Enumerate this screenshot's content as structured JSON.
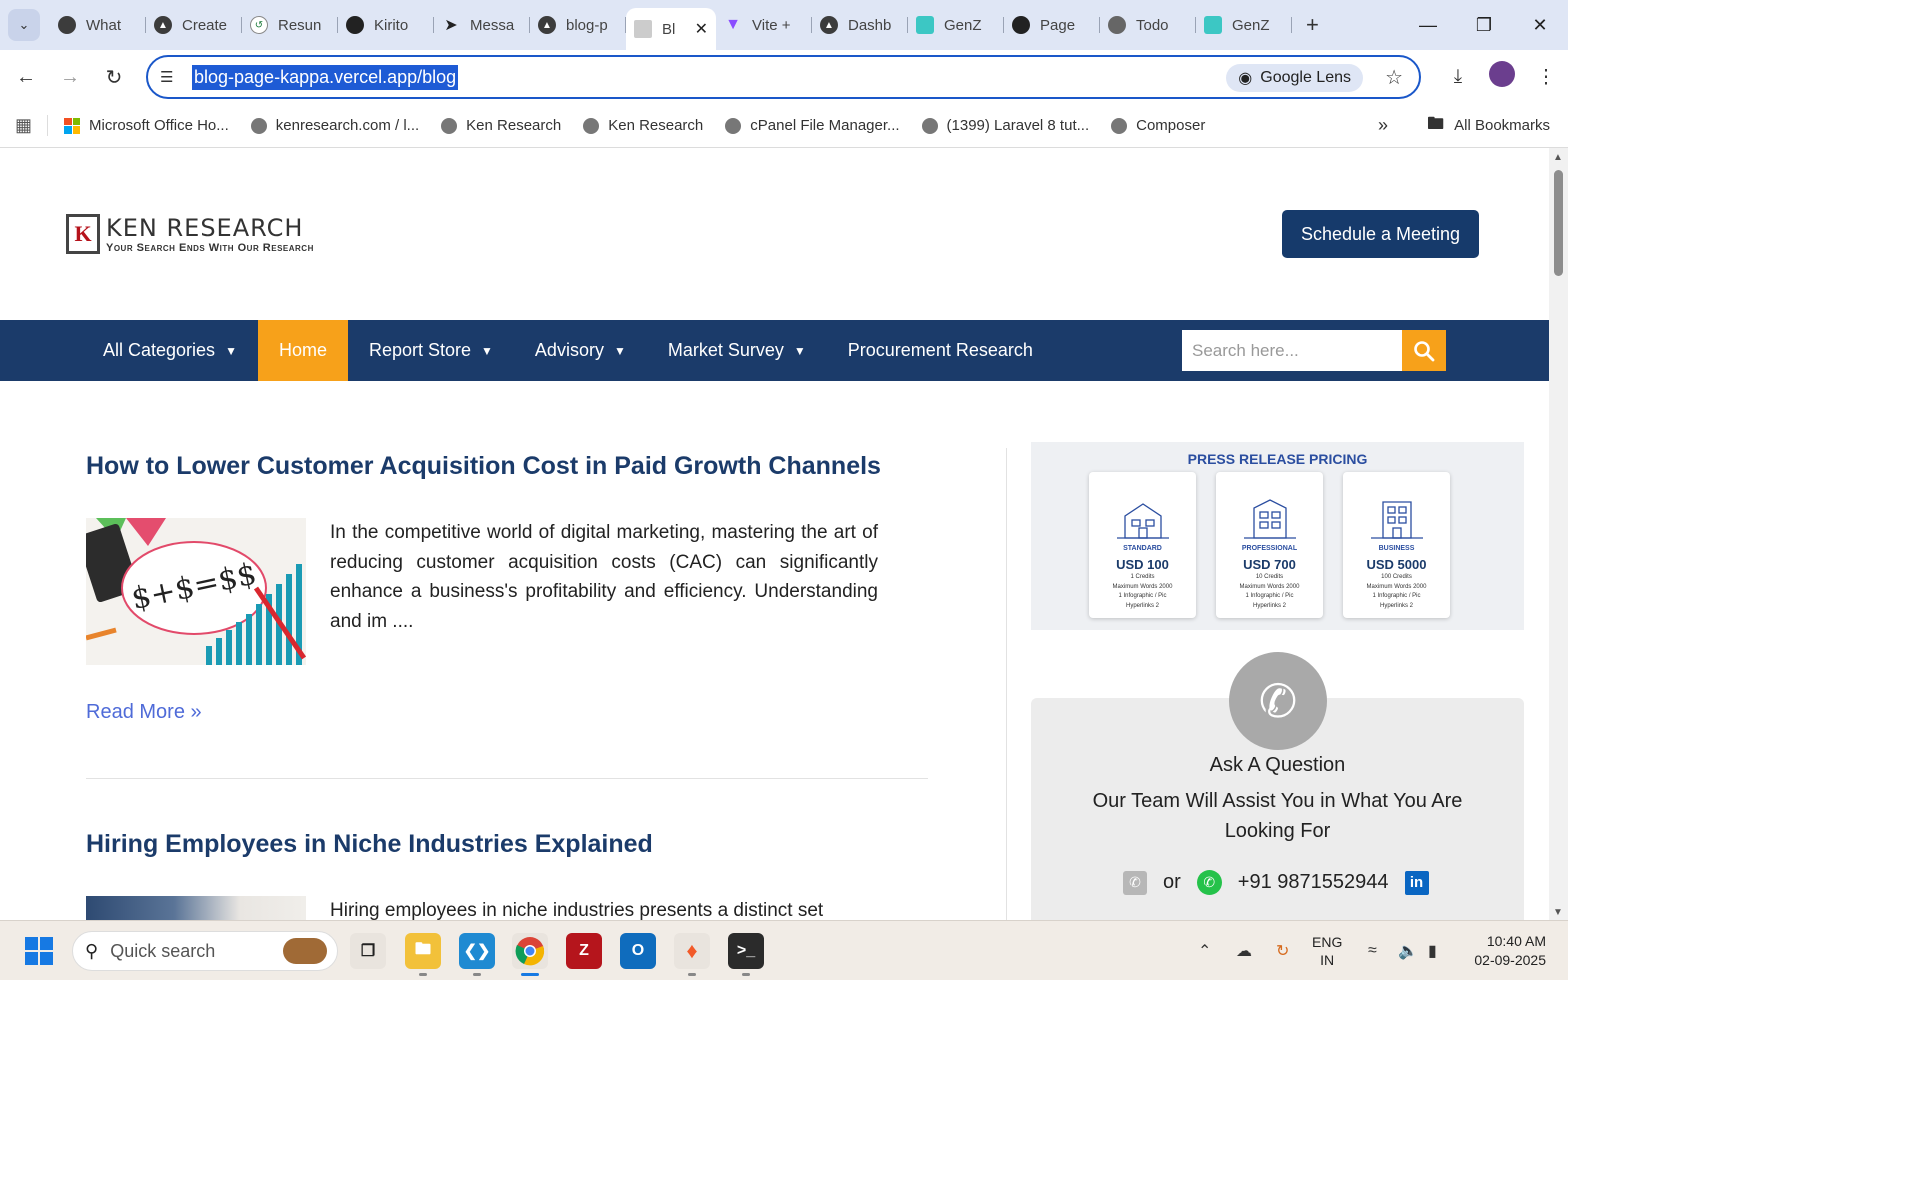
{
  "browser": {
    "tabs": [
      {
        "label": "What"
      },
      {
        "label": "Create"
      },
      {
        "label": "Resun"
      },
      {
        "label": "Kirito"
      },
      {
        "label": "Messa"
      },
      {
        "label": "blog-p"
      },
      {
        "label": "Bl",
        "active": true
      },
      {
        "label": "Vite +"
      },
      {
        "label": "Dashb"
      },
      {
        "label": "GenZ"
      },
      {
        "label": "Page"
      },
      {
        "label": "Todo"
      },
      {
        "label": "GenZ"
      }
    ],
    "url": "blog-page-kappa.vercel.app/blog",
    "lens_label": "Google Lens",
    "bookmarks": [
      "Microsoft Office Ho...",
      "kenresearch.com / l...",
      "Ken Research",
      "Ken Research",
      "cPanel File Manager...",
      "(1399) Laravel 8 tut...",
      "Composer"
    ],
    "all_bookmarks": "All Bookmarks"
  },
  "site": {
    "logo_name": "KEN RESEARCH",
    "logo_tagline": "Your Search Ends With Our Research",
    "schedule_button": "Schedule a Meeting",
    "nav": {
      "all_categories": "All Categories",
      "home": "Home",
      "report_store": "Report Store",
      "advisory": "Advisory",
      "market_survey": "Market Survey",
      "procurement": "Procurement Research"
    },
    "search_placeholder": "Search here...",
    "posts": [
      {
        "title": "How to Lower Customer Acquisition Cost in Paid Growth Channels",
        "excerpt": "In the competitive world of digital marketing, mastering the art of reducing customer acquisition costs (CAC) can significantly enhance a business's profitability and efficiency. Understanding and im ....",
        "read_more": "Read More »",
        "image_text": "$+$=$$"
      },
      {
        "title": "Hiring Employees in Niche Industries Explained",
        "excerpt": "Hiring employees in niche industries presents a distinct set"
      }
    ],
    "pricing": {
      "title": "PRESS RELEASE PRICING",
      "plans": [
        {
          "name": "STANDARD",
          "price": "USD 100",
          "credits": "1 Credits",
          "words": "Maximum Words 2000",
          "infographic": "1 Infographic / Pic",
          "links": "Hyperlinks 2"
        },
        {
          "name": "PROFESSIONAL",
          "price": "USD 700",
          "credits": "10 Credits",
          "words": "Maximum Words 2000",
          "infographic": "1 Infographic / Pic",
          "links": "Hyperlinks 2"
        },
        {
          "name": "BUSINESS",
          "price": "USD 5000",
          "credits": "100 Credits",
          "words": "Maximum Words 2000",
          "infographic": "1 Infographic / Pic",
          "links": "Hyperlinks 2"
        }
      ]
    },
    "ask": {
      "title": "Ask A Question",
      "text": "Our Team Will Assist You in What You Are Looking For",
      "or": "or",
      "phone": "+91 9871552944"
    }
  },
  "taskbar": {
    "search_placeholder": "Quick search",
    "lang_line1": "ENG",
    "lang_line2": "IN",
    "time": "10:40 AM",
    "date": "02-09-2025"
  },
  "colors": {
    "brand_navy": "#1b3b6a",
    "accent_orange": "#f7a11a",
    "link_blue": "#4f6bd8"
  }
}
